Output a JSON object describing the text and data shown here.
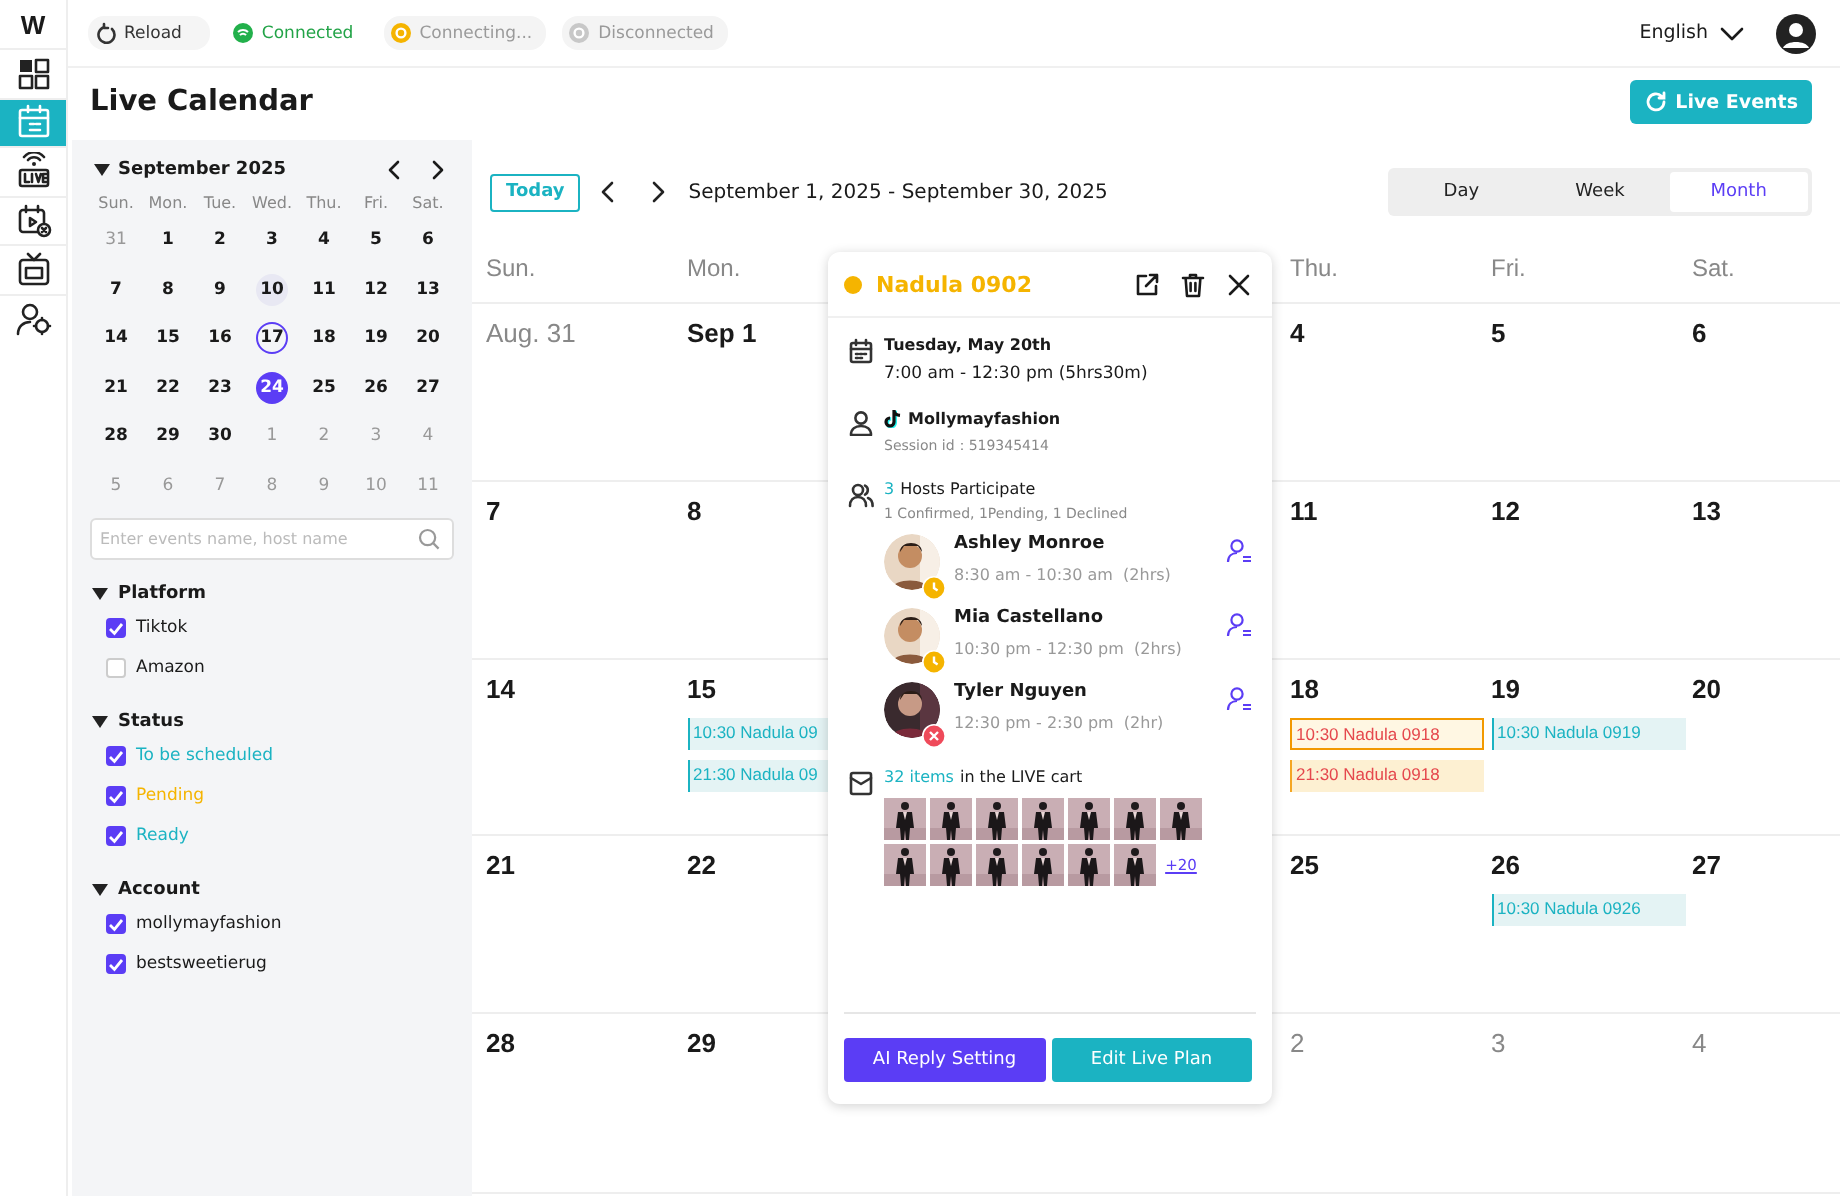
{
  "rail": {
    "logo": "W",
    "items": [
      {
        "kind": "dashboard",
        "selected": false
      },
      {
        "kind": "calendar",
        "selected": true
      },
      {
        "kind": "live",
        "selected": false
      },
      {
        "kind": "schedule",
        "selected": false
      },
      {
        "kind": "tv",
        "selected": false
      },
      {
        "kind": "users",
        "selected": false
      }
    ]
  },
  "topbar": {
    "statuses": [
      {
        "kind": "reload",
        "label": "Reload"
      },
      {
        "kind": "connected",
        "label": "Connected"
      },
      {
        "kind": "connecting",
        "label": "Connecting..."
      },
      {
        "kind": "disconnected",
        "label": "Disconnected"
      }
    ],
    "language": "English"
  },
  "title": "Live Calendar",
  "live_events_button": "Live Events",
  "sidebar": {
    "month": "September 2025",
    "weekdays": [
      "Sun.",
      "Mon.",
      "Tue.",
      "Wed.",
      "Thu.",
      "Fri.",
      "Sat."
    ],
    "weeks": [
      [
        {
          "d": "31",
          "kind": "other"
        },
        {
          "d": "1",
          "kind": "day"
        },
        {
          "d": "2",
          "kind": "day"
        },
        {
          "d": "3",
          "kind": "day"
        },
        {
          "d": "4",
          "kind": "day"
        },
        {
          "d": "5",
          "kind": "day"
        },
        {
          "d": "6",
          "kind": "day"
        }
      ],
      [
        {
          "d": "7",
          "kind": "day"
        },
        {
          "d": "8",
          "kind": "day"
        },
        {
          "d": "9",
          "kind": "day"
        },
        {
          "d": "10",
          "kind": "hover"
        },
        {
          "d": "11",
          "kind": "day"
        },
        {
          "d": "12",
          "kind": "day"
        },
        {
          "d": "13",
          "kind": "day"
        }
      ],
      [
        {
          "d": "14",
          "kind": "day"
        },
        {
          "d": "15",
          "kind": "day"
        },
        {
          "d": "16",
          "kind": "day"
        },
        {
          "d": "17",
          "kind": "today"
        },
        {
          "d": "18",
          "kind": "day"
        },
        {
          "d": "19",
          "kind": "day"
        },
        {
          "d": "20",
          "kind": "day"
        }
      ],
      [
        {
          "d": "21",
          "kind": "day"
        },
        {
          "d": "22",
          "kind": "day"
        },
        {
          "d": "23",
          "kind": "day"
        },
        {
          "d": "24",
          "kind": "selected"
        },
        {
          "d": "25",
          "kind": "day"
        },
        {
          "d": "26",
          "kind": "day"
        },
        {
          "d": "27",
          "kind": "day"
        }
      ],
      [
        {
          "d": "28",
          "kind": "day"
        },
        {
          "d": "29",
          "kind": "day"
        },
        {
          "d": "30",
          "kind": "day"
        },
        {
          "d": "1",
          "kind": "other"
        },
        {
          "d": "2",
          "kind": "other"
        },
        {
          "d": "3",
          "kind": "other"
        },
        {
          "d": "4",
          "kind": "other"
        }
      ],
      [
        {
          "d": "5",
          "kind": "other"
        },
        {
          "d": "6",
          "kind": "other"
        },
        {
          "d": "7",
          "kind": "other"
        },
        {
          "d": "8",
          "kind": "other"
        },
        {
          "d": "9",
          "kind": "other"
        },
        {
          "d": "10",
          "kind": "other"
        },
        {
          "d": "11",
          "kind": "other"
        }
      ]
    ],
    "search": {
      "placeholder": "Enter events name, host name"
    },
    "filters": [
      {
        "title": "Platform",
        "expanded": true,
        "options": [
          {
            "label": "Tiktok",
            "checked": true
          },
          {
            "label": "Amazon",
            "checked": false
          }
        ]
      },
      {
        "title": "Status",
        "expanded": true,
        "options": [
          {
            "label": "To be scheduled",
            "checked": true,
            "color": "#1bb3c2"
          },
          {
            "label": "Pending",
            "checked": true,
            "color": "#f5b400"
          },
          {
            "label": "Ready",
            "checked": true,
            "color": "#1bb3c2"
          }
        ]
      },
      {
        "title": "Account",
        "expanded": true,
        "options": [
          {
            "label": "mollymayfashion",
            "checked": true
          },
          {
            "label": "bestsweetierug",
            "checked": true
          }
        ]
      }
    ]
  },
  "toolbar": {
    "today": "Today",
    "range": "September 1, 2025 - September 30, 2025",
    "views": [
      {
        "label": "Day",
        "selected": false
      },
      {
        "label": "Week",
        "selected": false
      },
      {
        "label": "Month",
        "selected": true
      }
    ]
  },
  "calendar": {
    "columns": [
      {
        "weekday": "Sun.",
        "days": [
          {
            "date": "Aug. 31",
            "muted": true
          },
          {
            "date": "7",
            "muted": false
          },
          {
            "date": "14",
            "muted": false
          },
          {
            "date": "21",
            "muted": false
          },
          {
            "date": "28",
            "muted": false
          }
        ]
      },
      {
        "weekday": "Mon.",
        "days": [
          {
            "date": "Sep 1",
            "muted": false
          },
          {
            "date": "8",
            "muted": false
          },
          {
            "date": "15",
            "muted": false,
            "events": [
              {
                "label": "10:30 Nadula 09",
                "kind": "ready",
                "selected": false
              },
              {
                "label": "21:30 Nadula 09",
                "kind": "ready",
                "selected": false
              }
            ]
          },
          {
            "date": "22",
            "muted": false
          },
          {
            "date": "29",
            "muted": false
          }
        ]
      },
      {
        "weekday": "Thu.",
        "days": [
          {
            "date": "4",
            "muted": false
          },
          {
            "date": "11",
            "muted": false
          },
          {
            "date": "18",
            "muted": false,
            "events": [
              {
                "label": "10:30 Nadula 0918",
                "kind": "pending",
                "selected": true
              },
              {
                "label": "21:30 Nadula 0918",
                "kind": "pending",
                "selected": false
              }
            ]
          },
          {
            "date": "25",
            "muted": false
          },
          {
            "date": "2",
            "muted": true
          }
        ]
      },
      {
        "weekday": "Fri.",
        "days": [
          {
            "date": "5",
            "muted": false
          },
          {
            "date": "12",
            "muted": false
          },
          {
            "date": "19",
            "muted": false,
            "events": [
              {
                "label": "10:30 Nadula 0919",
                "kind": "ready",
                "selected": false
              }
            ]
          },
          {
            "date": "26",
            "muted": false,
            "events": [
              {
                "label": "10:30 Nadula 0926",
                "kind": "ready",
                "selected": false
              }
            ]
          },
          {
            "date": "3",
            "muted": true
          }
        ]
      },
      {
        "weekday": "Sat.",
        "days": [
          {
            "date": "6",
            "muted": false
          },
          {
            "date": "13",
            "muted": false
          },
          {
            "date": "20",
            "muted": false
          },
          {
            "date": "27",
            "muted": false
          },
          {
            "date": "4",
            "muted": true
          }
        ]
      }
    ]
  },
  "popover": {
    "title": "Nadula 0902",
    "color": "#f5b400",
    "date": "Tuesday, May 20th",
    "time": "7:00 am - 12:30 pm  (5hrs30m)",
    "account": "Mollymayfashion",
    "session": "Session id：519345414",
    "hosts_count": "3",
    "hosts_label": "Hosts Participate",
    "hosts_summary": "1 Confirmed, 1Pending, 1 Declined",
    "hosts": [
      {
        "name": "Ashley Monroe",
        "time": "8:30 am - 10:30 am  (2hrs)",
        "kind": "pending"
      },
      {
        "name": "Mia Castellano",
        "time": "10:30 pm - 12:30 pm  (2hrs)",
        "kind": "pending"
      },
      {
        "name": "Tyler Nguyen",
        "time": "12:30 pm - 2:30 pm  (2hr)",
        "kind": "declined"
      }
    ],
    "cart_count": "32 items",
    "cart_label": "in the LIVE cart",
    "more": "+20",
    "buttons": [
      {
        "label": "AI Reply Setting",
        "kind": "primary"
      },
      {
        "label": "Edit Live Plan",
        "kind": "secondary"
      }
    ]
  }
}
